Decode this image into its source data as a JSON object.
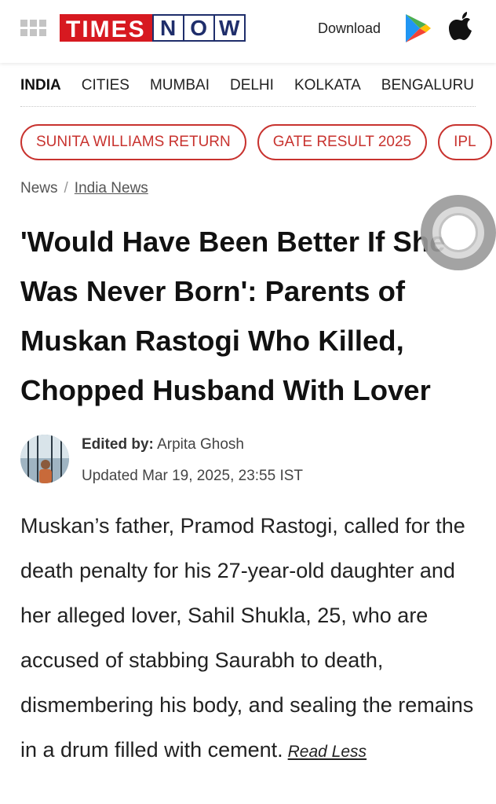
{
  "header": {
    "logo_times": "TIMES",
    "logo_now": [
      "N",
      "O",
      "W"
    ],
    "download_label": "Download",
    "icons": [
      "grid-icon",
      "google-play-icon",
      "apple-icon"
    ]
  },
  "nav": {
    "items": [
      {
        "label": "INDIA",
        "active": true
      },
      {
        "label": "CITIES",
        "active": false
      },
      {
        "label": "MUMBAI",
        "active": false
      },
      {
        "label": "DELHI",
        "active": false
      },
      {
        "label": "KOLKATA",
        "active": false
      },
      {
        "label": "BENGALURU",
        "active": false
      }
    ]
  },
  "pills": [
    {
      "label": "SUNITA WILLIAMS RETURN"
    },
    {
      "label": "GATE RESULT 2025"
    },
    {
      "label": "IPL"
    }
  ],
  "breadcrumb": {
    "root": "News",
    "separator": "/",
    "current": "India News"
  },
  "article": {
    "title": "'Would Have Been Better If She Was Never Born': Parents of Muskan Rastogi Who Killed, Chopped Husband With Lover",
    "edited_by_label": "Edited by:",
    "editor": "Arpita Ghosh",
    "updated": "Updated Mar 19, 2025, 23:55 IST",
    "summary": "Muskan’s father, Pramod Rastogi, called for the death penalty for his 27-year-old daughter and her alleged lover, Sahil Shukla, 25, who are accused of stabbing Saurabh to death, dismembering his body, and sealing the remains in a drum filled with cement.",
    "read_less": "Read Less"
  },
  "colors": {
    "brand_red": "#d71920",
    "brand_navy": "#1f2e6b",
    "pill_red": "#c8332f"
  }
}
